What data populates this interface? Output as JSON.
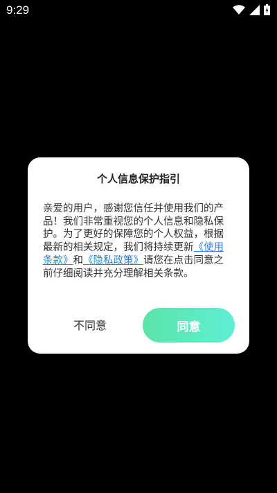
{
  "status_bar": {
    "time": "9:29",
    "icons": [
      "wifi-icon",
      "signal-icon",
      "battery-charging-icon"
    ]
  },
  "dialog": {
    "title": "个人信息保护指引",
    "body_part1": "亲爱的用户，感谢您信任并使用我们的产品！我们非常重视您的个人信息和隐私保护。为了更好的保障您的个人权益，根据最新的相关规定，我们将持续更新",
    "link_terms": "《使用条款》",
    "connector": "和",
    "link_privacy": "《隐私政策》",
    "body_part2": "请您在点击同意之前仔细阅读并充分理解相关条款。",
    "decline_label": "不同意",
    "agree_label": "同意"
  },
  "colors": {
    "background": "#000000",
    "dialog": "#ffffff",
    "link": "#2f7fd8",
    "agree_gradient_start": "#5ce3a8",
    "agree_gradient_end": "#5ef0d4"
  }
}
